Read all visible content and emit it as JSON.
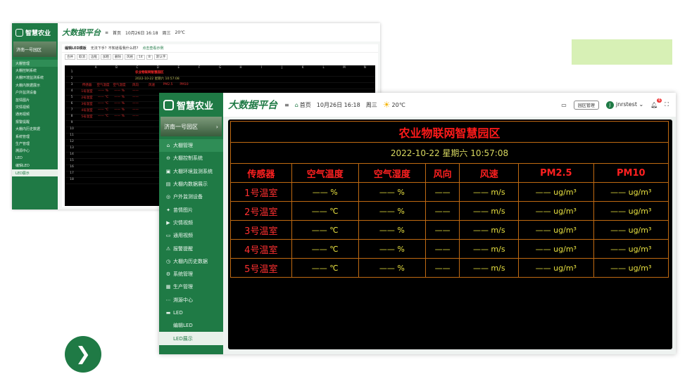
{
  "app": {
    "logo_text": "智慧农业",
    "platform_title": "大数据平台",
    "park": "济南一号园区",
    "home": "首页",
    "date": "10月26日 16:18",
    "weekday": "周三",
    "temperature": "20℃",
    "park_manage_btn": "园区管理",
    "user": "jnrstest",
    "user_initial": "J",
    "notifications": "6"
  },
  "sidebar": {
    "items": [
      {
        "icon": "⌂",
        "label": "大棚管理"
      },
      {
        "icon": "⊖",
        "label": "大棚控制系统"
      },
      {
        "icon": "▣",
        "label": "大棚环境监测系统"
      },
      {
        "icon": "▤",
        "label": "大棚内数据展示"
      },
      {
        "icon": "◎",
        "label": "户外监测设备"
      },
      {
        "icon": "✦",
        "label": "苗情图片"
      },
      {
        "icon": "▶",
        "label": "灾情视频"
      },
      {
        "icon": "▭",
        "label": "通用视频"
      },
      {
        "icon": "⚠",
        "label": "报警提醒"
      },
      {
        "icon": "◷",
        "label": "大棚内历史数据"
      },
      {
        "icon": "⚙",
        "label": "系统管理"
      },
      {
        "icon": "▦",
        "label": "生产管理"
      },
      {
        "icon": "⋯",
        "label": "溯源中心"
      },
      {
        "icon": "▬",
        "label": "LED"
      }
    ],
    "sub_items": [
      "编辑LED",
      "LED展示"
    ]
  },
  "editor": {
    "title": "编辑LED模板",
    "tip": "无法下手？不知道看我什么样?",
    "tip_link": "点击查看示例",
    "tools": [
      "合并",
      "取消",
      "边框",
      "加粗",
      "删除",
      "风格",
      "14",
      "B",
      "默认字"
    ],
    "columns": [
      "A",
      "B",
      "C",
      "D",
      "E",
      "F",
      "G",
      "H",
      "I",
      "J",
      "K",
      "L",
      "M",
      "N"
    ],
    "row_count": 18
  },
  "led": {
    "title": "农业物联网智慧园区",
    "datetime": "2022-10-22 星期六 10:57:08",
    "headers": [
      "传感器",
      "空气温度",
      "空气湿度",
      "风向",
      "风速",
      "PM2.5",
      "PM10"
    ],
    "rows": [
      {
        "name": "1号温室",
        "temp": "—— %",
        "hum": "—— %",
        "dir": "——",
        "speed": "—— m/s",
        "pm25": "—— ug/m³",
        "pm10": "—— ug/m³"
      },
      {
        "name": "2号温室",
        "temp": "—— ℃",
        "hum": "—— %",
        "dir": "——",
        "speed": "—— m/s",
        "pm25": "—— ug/m³",
        "pm10": "—— ug/m³"
      },
      {
        "name": "3号温室",
        "temp": "—— ℃",
        "hum": "—— %",
        "dir": "——",
        "speed": "—— m/s",
        "pm25": "—— ug/m³",
        "pm10": "—— ug/m³"
      },
      {
        "name": "4号温室",
        "temp": "—— ℃",
        "hum": "—— %",
        "dir": "——",
        "speed": "—— m/s",
        "pm25": "—— ug/m³",
        "pm10": "—— ug/m³"
      },
      {
        "name": "5号温室",
        "temp": "—— ℃",
        "hum": "—— %",
        "dir": "——",
        "speed": "—— m/s",
        "pm25": "—— ug/m³",
        "pm10": "—— ug/m³"
      }
    ]
  },
  "next_icon": "❯"
}
